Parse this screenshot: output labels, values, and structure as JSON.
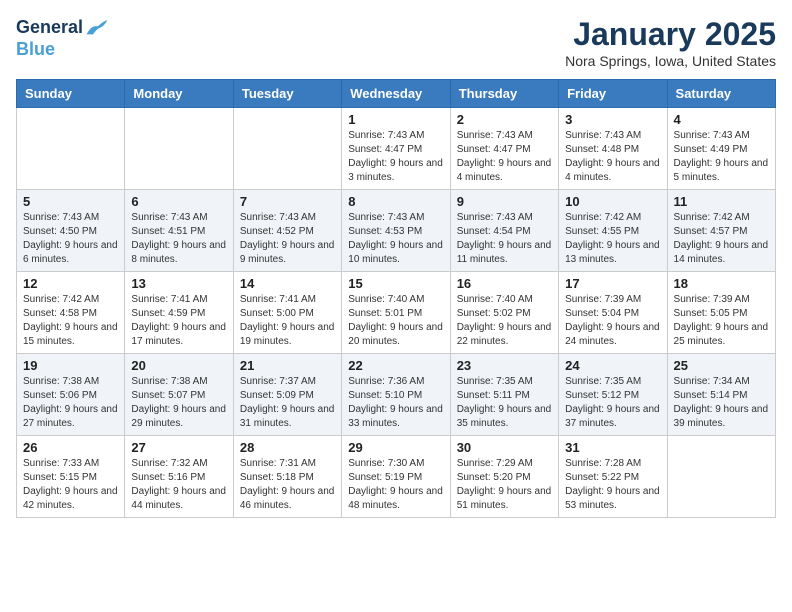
{
  "header": {
    "logo_line1": "General",
    "logo_line2": "Blue",
    "month_title": "January 2025",
    "location": "Nora Springs, Iowa, United States"
  },
  "days_of_week": [
    "Sunday",
    "Monday",
    "Tuesday",
    "Wednesday",
    "Thursday",
    "Friday",
    "Saturday"
  ],
  "weeks": [
    [
      {
        "day": "",
        "info": ""
      },
      {
        "day": "",
        "info": ""
      },
      {
        "day": "",
        "info": ""
      },
      {
        "day": "1",
        "info": "Sunrise: 7:43 AM\nSunset: 4:47 PM\nDaylight: 9 hours and 3 minutes."
      },
      {
        "day": "2",
        "info": "Sunrise: 7:43 AM\nSunset: 4:47 PM\nDaylight: 9 hours and 4 minutes."
      },
      {
        "day": "3",
        "info": "Sunrise: 7:43 AM\nSunset: 4:48 PM\nDaylight: 9 hours and 4 minutes."
      },
      {
        "day": "4",
        "info": "Sunrise: 7:43 AM\nSunset: 4:49 PM\nDaylight: 9 hours and 5 minutes."
      }
    ],
    [
      {
        "day": "5",
        "info": "Sunrise: 7:43 AM\nSunset: 4:50 PM\nDaylight: 9 hours and 6 minutes."
      },
      {
        "day": "6",
        "info": "Sunrise: 7:43 AM\nSunset: 4:51 PM\nDaylight: 9 hours and 8 minutes."
      },
      {
        "day": "7",
        "info": "Sunrise: 7:43 AM\nSunset: 4:52 PM\nDaylight: 9 hours and 9 minutes."
      },
      {
        "day": "8",
        "info": "Sunrise: 7:43 AM\nSunset: 4:53 PM\nDaylight: 9 hours and 10 minutes."
      },
      {
        "day": "9",
        "info": "Sunrise: 7:43 AM\nSunset: 4:54 PM\nDaylight: 9 hours and 11 minutes."
      },
      {
        "day": "10",
        "info": "Sunrise: 7:42 AM\nSunset: 4:55 PM\nDaylight: 9 hours and 13 minutes."
      },
      {
        "day": "11",
        "info": "Sunrise: 7:42 AM\nSunset: 4:57 PM\nDaylight: 9 hours and 14 minutes."
      }
    ],
    [
      {
        "day": "12",
        "info": "Sunrise: 7:42 AM\nSunset: 4:58 PM\nDaylight: 9 hours and 15 minutes."
      },
      {
        "day": "13",
        "info": "Sunrise: 7:41 AM\nSunset: 4:59 PM\nDaylight: 9 hours and 17 minutes."
      },
      {
        "day": "14",
        "info": "Sunrise: 7:41 AM\nSunset: 5:00 PM\nDaylight: 9 hours and 19 minutes."
      },
      {
        "day": "15",
        "info": "Sunrise: 7:40 AM\nSunset: 5:01 PM\nDaylight: 9 hours and 20 minutes."
      },
      {
        "day": "16",
        "info": "Sunrise: 7:40 AM\nSunset: 5:02 PM\nDaylight: 9 hours and 22 minutes."
      },
      {
        "day": "17",
        "info": "Sunrise: 7:39 AM\nSunset: 5:04 PM\nDaylight: 9 hours and 24 minutes."
      },
      {
        "day": "18",
        "info": "Sunrise: 7:39 AM\nSunset: 5:05 PM\nDaylight: 9 hours and 25 minutes."
      }
    ],
    [
      {
        "day": "19",
        "info": "Sunrise: 7:38 AM\nSunset: 5:06 PM\nDaylight: 9 hours and 27 minutes."
      },
      {
        "day": "20",
        "info": "Sunrise: 7:38 AM\nSunset: 5:07 PM\nDaylight: 9 hours and 29 minutes."
      },
      {
        "day": "21",
        "info": "Sunrise: 7:37 AM\nSunset: 5:09 PM\nDaylight: 9 hours and 31 minutes."
      },
      {
        "day": "22",
        "info": "Sunrise: 7:36 AM\nSunset: 5:10 PM\nDaylight: 9 hours and 33 minutes."
      },
      {
        "day": "23",
        "info": "Sunrise: 7:35 AM\nSunset: 5:11 PM\nDaylight: 9 hours and 35 minutes."
      },
      {
        "day": "24",
        "info": "Sunrise: 7:35 AM\nSunset: 5:12 PM\nDaylight: 9 hours and 37 minutes."
      },
      {
        "day": "25",
        "info": "Sunrise: 7:34 AM\nSunset: 5:14 PM\nDaylight: 9 hours and 39 minutes."
      }
    ],
    [
      {
        "day": "26",
        "info": "Sunrise: 7:33 AM\nSunset: 5:15 PM\nDaylight: 9 hours and 42 minutes."
      },
      {
        "day": "27",
        "info": "Sunrise: 7:32 AM\nSunset: 5:16 PM\nDaylight: 9 hours and 44 minutes."
      },
      {
        "day": "28",
        "info": "Sunrise: 7:31 AM\nSunset: 5:18 PM\nDaylight: 9 hours and 46 minutes."
      },
      {
        "day": "29",
        "info": "Sunrise: 7:30 AM\nSunset: 5:19 PM\nDaylight: 9 hours and 48 minutes."
      },
      {
        "day": "30",
        "info": "Sunrise: 7:29 AM\nSunset: 5:20 PM\nDaylight: 9 hours and 51 minutes."
      },
      {
        "day": "31",
        "info": "Sunrise: 7:28 AM\nSunset: 5:22 PM\nDaylight: 9 hours and 53 minutes."
      },
      {
        "day": "",
        "info": ""
      }
    ]
  ]
}
